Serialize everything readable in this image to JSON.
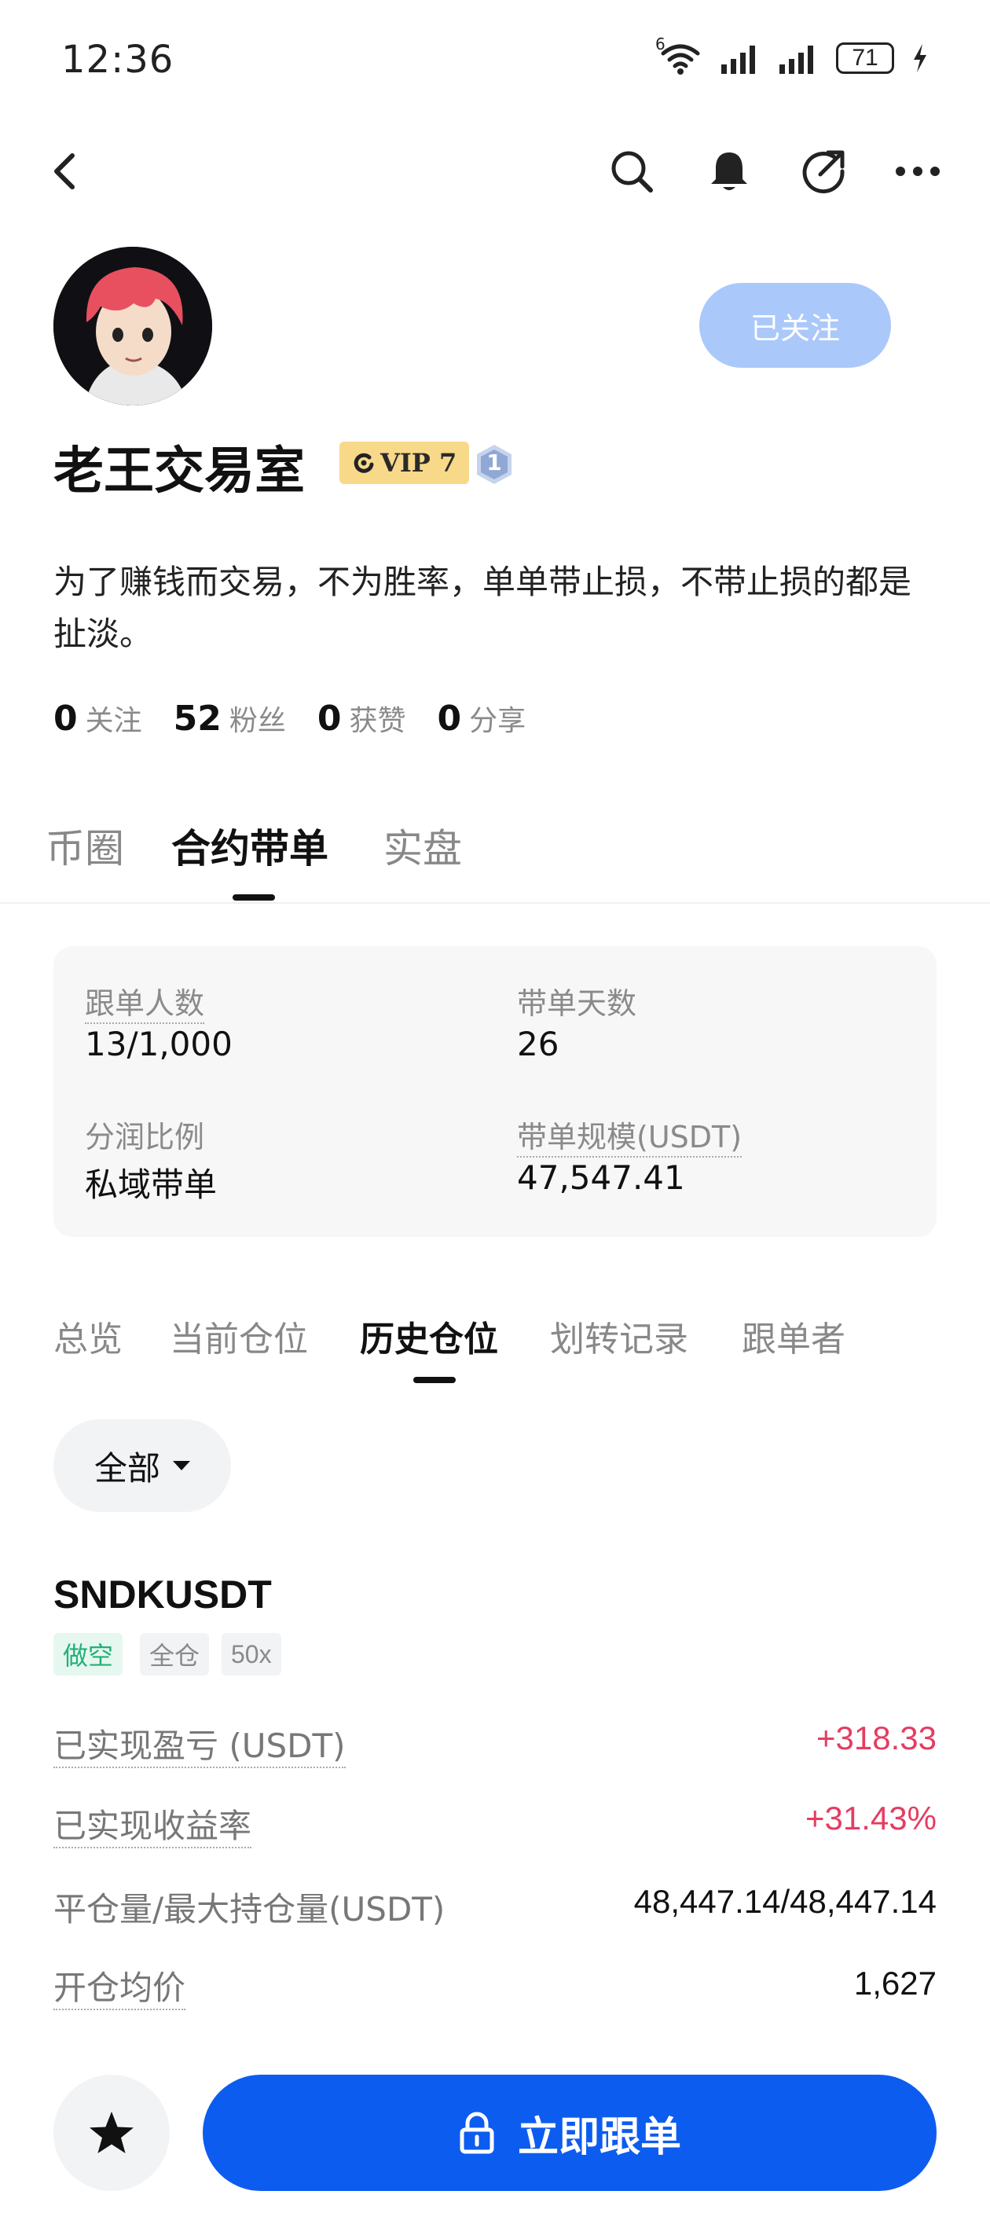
{
  "status_bar": {
    "time": "12:36",
    "network_sup": "6",
    "battery": "71",
    "icons": [
      "wifi-icon",
      "signal-icon",
      "signal-icon",
      "battery-icon",
      "charging-icon"
    ]
  },
  "nav": {
    "icons": [
      "back-arrow-icon",
      "search-icon",
      "bell-icon",
      "share-icon",
      "more-icon"
    ]
  },
  "profile": {
    "follow_label": "已关注",
    "name": "老王交易室",
    "vip_label": "VIP 7",
    "level": "1",
    "bio": "为了赚钱而交易，不为胜率，单单带止损，不带止损的都是扯淡。",
    "stats": [
      {
        "num": "0",
        "label": "关注"
      },
      {
        "num": "52",
        "label": "粉丝"
      },
      {
        "num": "0",
        "label": "获赞"
      },
      {
        "num": "0",
        "label": "分享"
      }
    ]
  },
  "main_tabs": [
    {
      "label": "币圈",
      "active": false
    },
    {
      "label": "合约带单",
      "active": true
    },
    {
      "label": "实盘",
      "active": false
    }
  ],
  "summary": {
    "followers_label": "跟单人数",
    "followers_value": "13/1,000",
    "days_label": "带单天数",
    "days_value": "26",
    "profit_share_label": "分润比例",
    "profit_share_value": "私域带单",
    "scale_label": "带单规模(USDT)",
    "scale_value": "47,547.41"
  },
  "sub_tabs": [
    {
      "label": "总览",
      "active": false
    },
    {
      "label": "当前仓位",
      "active": false
    },
    {
      "label": "历史仓位",
      "active": true
    },
    {
      "label": "划转记录",
      "active": false
    },
    {
      "label": "跟单者",
      "active": false
    }
  ],
  "filter": {
    "label": "全部"
  },
  "position": {
    "symbol": "SNDKUSDT",
    "tags": [
      "做空",
      "全仓",
      "50x"
    ],
    "rows": [
      {
        "label": "已实现盈亏 (USDT)",
        "value": "+318.33"
      },
      {
        "label": "已实现收益率",
        "value": "+31.43%"
      },
      {
        "label": "平仓量/最大持仓量(USDT)",
        "value": "48,447.14/48,447.14"
      },
      {
        "label": "开仓均价",
        "value": "1,627"
      }
    ]
  },
  "bottom": {
    "copy_label": "立即跟单"
  },
  "colors": {
    "primary": "#0d5cf0",
    "follow_bg": "#abc8fb",
    "profit": "#e53d62",
    "short_tag": "#22b07a",
    "vip_bg": "#f8d98a"
  }
}
